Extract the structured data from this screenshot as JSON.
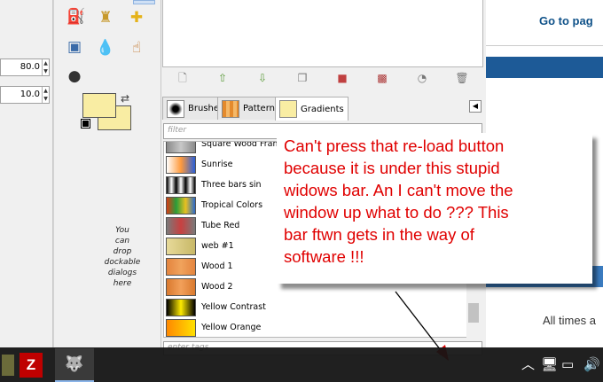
{
  "tool_options": {
    "spin1_value": "80.0",
    "spin2_value": "10.0"
  },
  "toolbox": {
    "drop_hint": "You\ncan\ndrop\ndockable\ndialogs\nhere",
    "colors": {
      "foreground": "#f9eda3",
      "background": "#f9eda3"
    }
  },
  "dock": {
    "tabs": [
      {
        "label": "Brushes",
        "icon": "brush-thumbnail"
      },
      {
        "label": "Patterns",
        "icon": "pattern-thumbnail"
      },
      {
        "label": "Gradients",
        "icon": "gradient-thumbnail"
      }
    ],
    "filter_placeholder": "filter",
    "tags_placeholder": "enter tags",
    "gradients": [
      {
        "name": "Square Wood Frame",
        "colors": [
          "#8a8a8a",
          "#c8c8c8",
          "#8a8a8a"
        ]
      },
      {
        "name": "Sunrise",
        "colors": [
          "#ffffff",
          "#ff9a3c",
          "#2a5fd6"
        ]
      },
      {
        "name": "Three bars sin",
        "colors": [
          "#000",
          "#fff",
          "#000",
          "#fff",
          "#000",
          "#fff",
          "#000"
        ]
      },
      {
        "name": "Tropical Colors",
        "colors": [
          "#d43c16",
          "#2a9d3a",
          "#e8c020",
          "#2b6ac9"
        ]
      },
      {
        "name": "Tube Red",
        "colors": [
          "#7a7a7a",
          "#c84040",
          "#7a7a7a"
        ]
      },
      {
        "name": "web #1",
        "colors": [
          "#e7da9a",
          "#c8b867"
        ]
      },
      {
        "name": "Wood 1",
        "colors": [
          "#e4843e",
          "#f0a35c",
          "#e4843e"
        ]
      },
      {
        "name": "Wood 2",
        "colors": [
          "#d9792e",
          "#f2a05a",
          "#d9792e"
        ]
      },
      {
        "name": "Yellow Contrast",
        "colors": [
          "#000",
          "#ffea00",
          "#000"
        ]
      },
      {
        "name": "Yellow Orange",
        "colors": [
          "#ff8800",
          "#ffe000"
        ]
      }
    ]
  },
  "browser": {
    "goto_text": "Go to pag",
    "all_times_text": "All times a"
  },
  "callout": {
    "text": "Can't press that re-load button\nbecause it is under this stupid\nwidows bar. An I can't move the\nwindow up   what to do ??? This\nbar ftwn gets in the way of\nsoftware !!!"
  },
  "taskbar": {
    "apps": [
      {
        "name": "FileZilla",
        "glyph": "Z"
      },
      {
        "name": "GIMP",
        "glyph": "🐺"
      }
    ]
  }
}
